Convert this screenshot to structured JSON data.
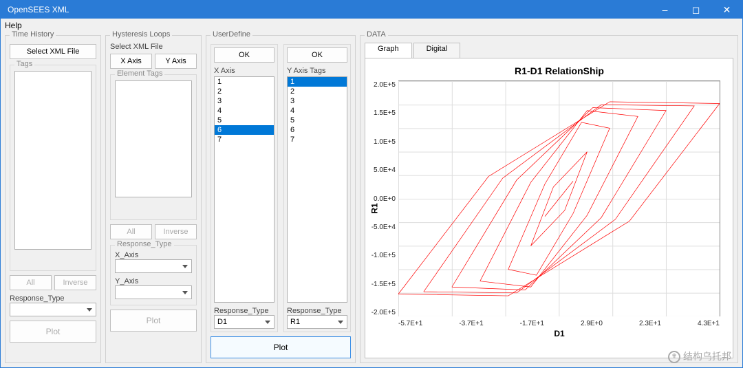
{
  "window": {
    "title": "OpenSEES XML"
  },
  "menubar": {
    "help": "Help"
  },
  "panels": {
    "time_history": {
      "title": "Time History",
      "select_xml": "Select XML File",
      "tags_label": "Tags",
      "all": "All",
      "inverse": "Inverse",
      "response_type_label": "Response_Type",
      "plot": "Plot"
    },
    "hysteresis": {
      "title": "Hysteresis Loops",
      "select_xml_label": "Select XML File",
      "xaxis_btn": "X Axis",
      "yaxis_btn": "Y Axis",
      "element_tags_label": "Element Tags",
      "all": "All",
      "inverse": "Inverse",
      "response_type_label": "Response_Type",
      "xaxis_label": "X_Axis",
      "yaxis_label": "Y_Axis",
      "plot": "Plot"
    },
    "userdefine": {
      "title": "UserDefine",
      "ok": "OK",
      "xaxis_label": "X Axis",
      "yaxis_tags_label": "Y Axis Tags",
      "x_items": [
        "1",
        "2",
        "3",
        "4",
        "5",
        "6",
        "7"
      ],
      "x_selected": "6",
      "y_items": [
        "1",
        "2",
        "3",
        "4",
        "5",
        "6",
        "7"
      ],
      "y_selected": "1",
      "response_type_label": "Response_Type",
      "x_response": "D1",
      "y_response": "R1",
      "plot": "Plot"
    },
    "data": {
      "title": "DATA",
      "tab_graph": "Graph",
      "tab_digital": "Digital"
    }
  },
  "watermark": "结构乌托邦",
  "chart_data": {
    "type": "line",
    "title": "R1-D1 RelationShip",
    "xlabel": "D1",
    "ylabel": "R1",
    "xlim": [
      -57,
      57
    ],
    "ylim": [
      -200000,
      200000
    ],
    "xticks": [
      "-5.7E+1",
      "-3.7E+1",
      "-1.7E+1",
      "2.9E+0",
      "2.3E+1",
      "4.3E+1"
    ],
    "yticks": [
      "2.0E+5",
      "1.5E+5",
      "1.0E+5",
      "5.0E+4",
      "0.0E+0",
      "-5.0E+4",
      "-1.0E+5",
      "-1.5E+5",
      "-2.0E+5"
    ],
    "series": [
      {
        "name": "R1-D1",
        "color": "#ff0000",
        "loops_xy": [
          [
            [
              -5,
              -30000
            ],
            [
              5,
              30000
            ]
          ],
          [
            [
              -10,
              -80000
            ],
            [
              -2,
              20000
            ],
            [
              10,
              80000
            ],
            [
              2,
              -20000
            ],
            [
              -10,
              -80000
            ]
          ],
          [
            [
              -18,
              -120000
            ],
            [
              -5,
              25000
            ],
            [
              8,
              130000
            ],
            [
              18,
              120000
            ],
            [
              5,
              -25000
            ],
            [
              -8,
              -130000
            ],
            [
              -18,
              -120000
            ]
          ],
          [
            [
              -28,
              -140000
            ],
            [
              -10,
              28000
            ],
            [
              10,
              150000
            ],
            [
              28,
              140000
            ],
            [
              10,
              -28000
            ],
            [
              -10,
              -150000
            ],
            [
              -28,
              -140000
            ]
          ],
          [
            [
              -38,
              -150000
            ],
            [
              -15,
              32000
            ],
            [
              12,
              155000
            ],
            [
              38,
              150000
            ],
            [
              15,
              -32000
            ],
            [
              -12,
              -155000
            ],
            [
              -38,
              -150000
            ]
          ],
          [
            [
              -48,
              -158000
            ],
            [
              -20,
              35000
            ],
            [
              15,
              160000
            ],
            [
              48,
              158000
            ],
            [
              20,
              -35000
            ],
            [
              -15,
              -160000
            ],
            [
              -48,
              -158000
            ]
          ],
          [
            [
              -57,
              -162000
            ],
            [
              -25,
              38000
            ],
            [
              18,
              165000
            ],
            [
              57,
              162000
            ],
            [
              25,
              -38000
            ],
            [
              -18,
              -165000
            ],
            [
              -57,
              -162000
            ]
          ]
        ]
      }
    ]
  }
}
